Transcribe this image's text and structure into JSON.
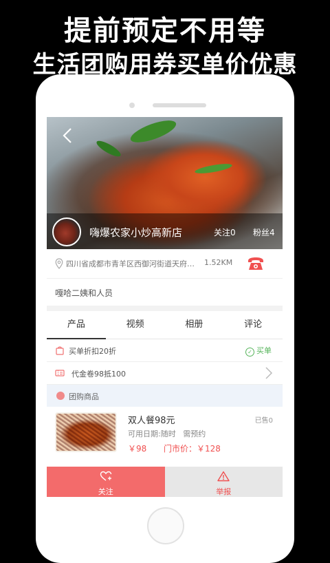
{
  "promo": {
    "line1": "提前预定不用等",
    "line2": "生活团购用券买单价优惠"
  },
  "shop": {
    "name": "嗨爆农家小炒高新店",
    "follow": "关注0",
    "fans": "粉丝4"
  },
  "address": {
    "text": "四川省成都市青羊区西御河街道天府…",
    "distance": "1.52KM"
  },
  "description": "嘎哈二姨和人员",
  "tabs": [
    {
      "label": "产品"
    },
    {
      "label": "视频"
    },
    {
      "label": "相册"
    },
    {
      "label": "评论"
    }
  ],
  "rows": {
    "discount": "买单折扣20折",
    "maidan": "买单",
    "voucher": "代金卷98抵100"
  },
  "group": {
    "title": "团购商品"
  },
  "deal": {
    "title": "双人餐98元",
    "sold": "已售0",
    "date": "可用日期:随时",
    "reserve": "需预约",
    "price": "￥98",
    "store_price": "门市价：￥128"
  },
  "bottom": {
    "follow": "关注",
    "report": "举报"
  },
  "colors": {
    "accent": "#f36b6b",
    "green": "#55b45a",
    "price": "#f05050"
  }
}
